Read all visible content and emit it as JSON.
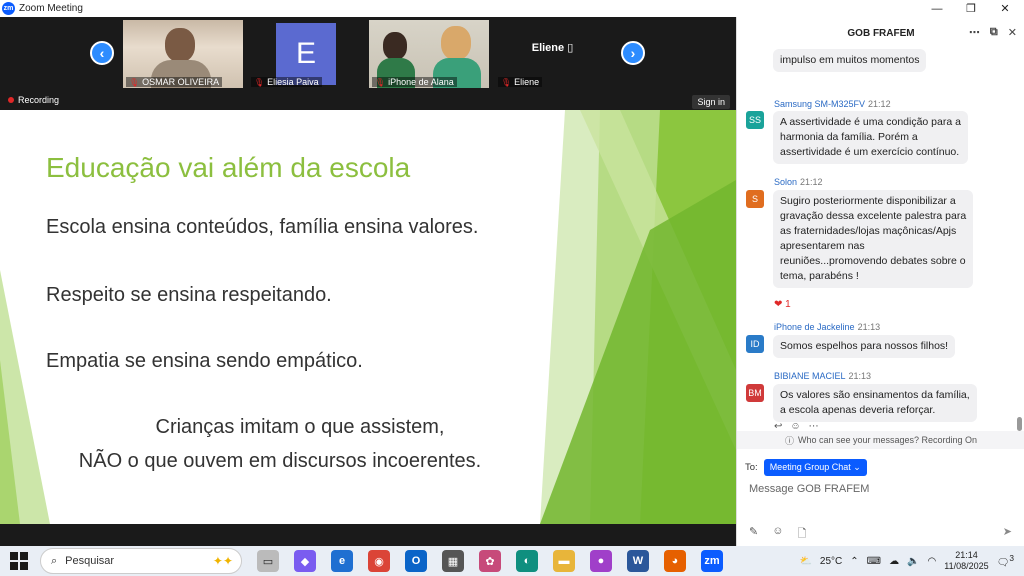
{
  "window": {
    "title": "Zoom Meeting",
    "controls": [
      "—",
      "❐",
      "✕"
    ]
  },
  "meeting": {
    "recording_label": "Recording",
    "signin_label": "Sign in",
    "participants": [
      {
        "name": "OSMAR OLIVEIRA"
      },
      {
        "name": "Eliesia Paiva",
        "initial": "E"
      },
      {
        "name": "iPhone de Alana"
      },
      {
        "name": "Eliene",
        "display": "Eliene ▯"
      }
    ]
  },
  "slide": {
    "title": "Educação vai além da escola",
    "lines": [
      "Escola ensina conteúdos, família ensina valores.",
      "Respeito se ensina respeitando.",
      "Empatia se ensina sendo empático."
    ],
    "quote": [
      "Crianças imitam o que assistem,",
      "NÃO o que ouvem em discursos incoerentes."
    ]
  },
  "chat": {
    "title": "GOB FRAFEM",
    "messages": [
      {
        "text": "impulso em muitos momentos"
      },
      {
        "sender": "Samsung SM-M325FV",
        "time": "21:12",
        "initials": "SS",
        "color": "#1aa39a",
        "text": [
          "A assertividade é uma condição para a",
          "harmonia da família. Porém a",
          "assertividade é um exercício contínuo."
        ]
      },
      {
        "sender": "Solon",
        "time": "21:12",
        "initials": "S",
        "color": "#e06d1f",
        "text": [
          "Sugiro posteriormente disponibilizar a",
          "gravação dessa excelente palestra para",
          "as fraternidades/lojas maçônicas/Apjs",
          "apresentarem nas",
          "reuniões...promovendo debates sobre o",
          "tema, parabéns !"
        ],
        "reaction": "❤ 1"
      },
      {
        "sender": "iPhone de Jackeline",
        "time": "21:13",
        "initials": "ID",
        "color": "#2a7bc8",
        "text": [
          "Somos espelhos para nossos filhos!"
        ]
      },
      {
        "sender": "BIBIANE MACIEL",
        "time": "21:13",
        "initials": "BM",
        "color": "#d03a3a",
        "text": [
          "Os valores são ensinamentos da família,",
          "a escola apenas deveria reforçar."
        ]
      }
    ],
    "privacy_note": "Who can see your messages? Recording On",
    "to_label": "To:",
    "to_target": "Meeting Group Chat ⌄",
    "input_placeholder": "Message GOB FRAFEM"
  },
  "taskbar": {
    "search_placeholder": "Pesquisar",
    "weather": "25°C",
    "time": "21:14",
    "date": "11/08/2025",
    "notifications": "3"
  }
}
